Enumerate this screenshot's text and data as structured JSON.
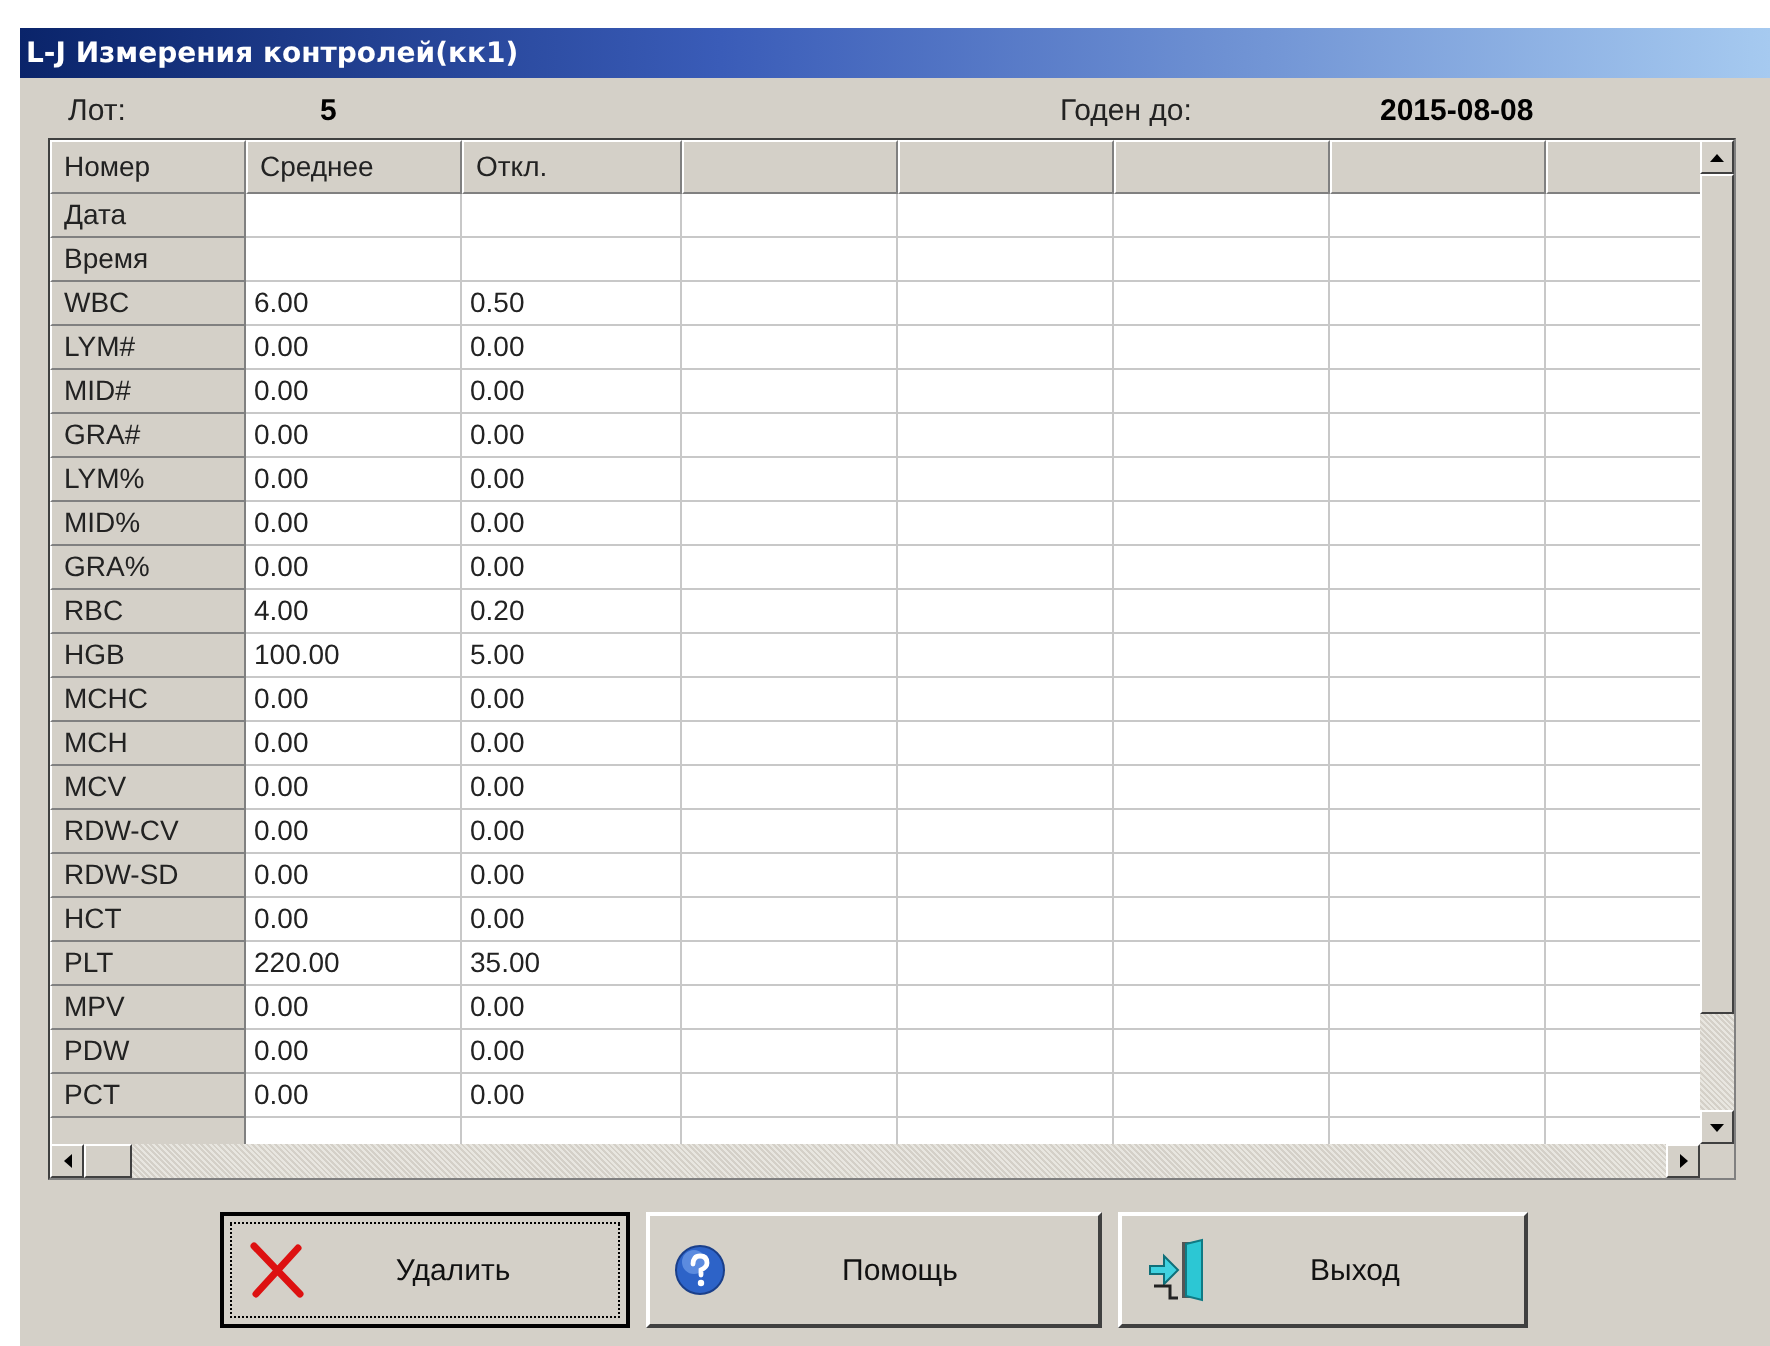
{
  "window": {
    "title": "L-J Измерения контролей(кк1)"
  },
  "info": {
    "lot_label": "Лот:",
    "lot_value": "5",
    "expiry_label": "Годен до:",
    "expiry_value": "2015-08-08"
  },
  "table": {
    "columns": [
      "Номер",
      "Среднее",
      "Откл."
    ],
    "rows": [
      {
        "name": "Дата"
      },
      {
        "name": "Время"
      },
      {
        "name": "WBC",
        "mean": "6.00",
        "dev": "0.50"
      },
      {
        "name": "LYM#",
        "mean": "0.00",
        "dev": "0.00"
      },
      {
        "name": "MID#",
        "mean": "0.00",
        "dev": "0.00"
      },
      {
        "name": "GRA#",
        "mean": "0.00",
        "dev": "0.00"
      },
      {
        "name": "LYM%",
        "mean": "0.00",
        "dev": "0.00"
      },
      {
        "name": "MID%",
        "mean": "0.00",
        "dev": "0.00"
      },
      {
        "name": "GRA%",
        "mean": "0.00",
        "dev": "0.00"
      },
      {
        "name": "RBC",
        "mean": "4.00",
        "dev": "0.20"
      },
      {
        "name": "HGB",
        "mean": "100.00",
        "dev": "5.00"
      },
      {
        "name": "MCHC",
        "mean": "0.00",
        "dev": "0.00"
      },
      {
        "name": "MCH",
        "mean": "0.00",
        "dev": "0.00"
      },
      {
        "name": "MCV",
        "mean": "0.00",
        "dev": "0.00"
      },
      {
        "name": "RDW-CV",
        "mean": "0.00",
        "dev": "0.00"
      },
      {
        "name": "RDW-SD",
        "mean": "0.00",
        "dev": "0.00"
      },
      {
        "name": "HCT",
        "mean": "0.00",
        "dev": "0.00"
      },
      {
        "name": "PLT",
        "mean": "220.00",
        "dev": "35.00"
      },
      {
        "name": "MPV",
        "mean": "0.00",
        "dev": "0.00"
      },
      {
        "name": "PDW",
        "mean": "0.00",
        "dev": "0.00"
      },
      {
        "name": "PCT",
        "mean": "0.00",
        "dev": "0.00"
      }
    ]
  },
  "buttons": [
    {
      "label": "Удалить",
      "kind": "delete",
      "focused": true
    },
    {
      "label": "Помощь",
      "kind": "help",
      "focused": false
    },
    {
      "label": "Выход",
      "kind": "exit",
      "focused": false
    }
  ]
}
